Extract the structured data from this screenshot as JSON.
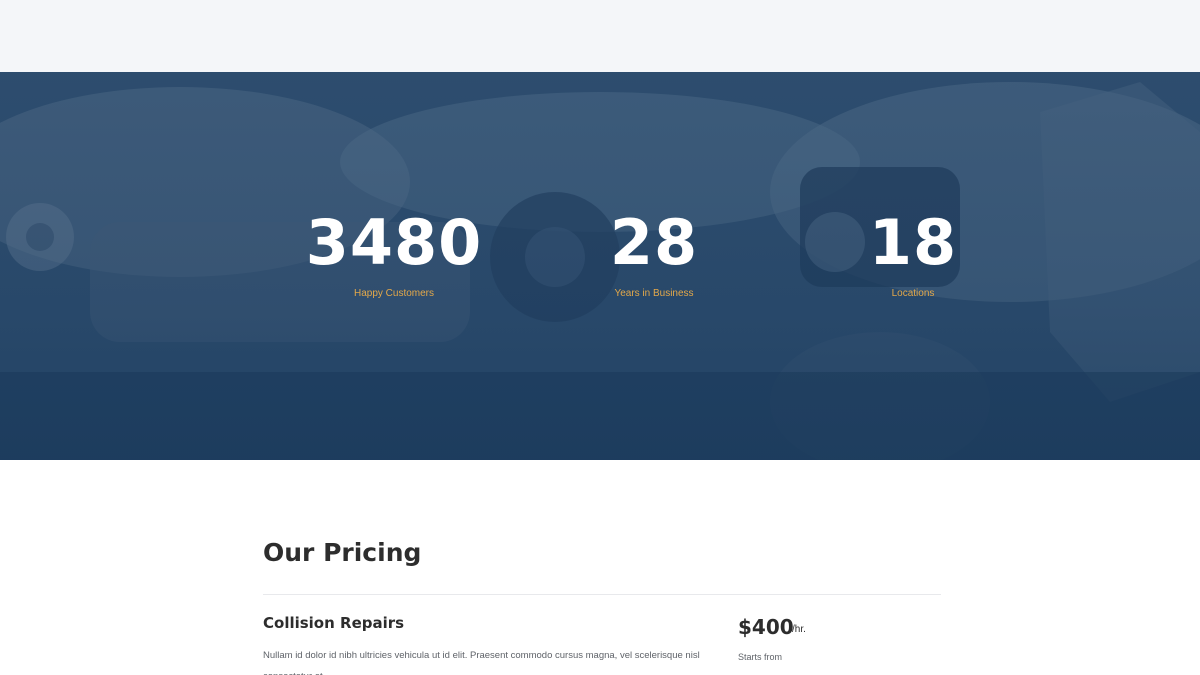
{
  "stats": [
    {
      "value": "3480",
      "label": "Happy Customers"
    },
    {
      "value": "28",
      "label": "Years in Business"
    },
    {
      "value": "18",
      "label": "Locations"
    }
  ],
  "pricing": {
    "title": "Our Pricing",
    "items": [
      {
        "name": "Collision Repairs",
        "description": "Nullam id dolor id nibh ultricies vehicula ut id elit. Praesent commodo cursus magna, vel scelerisque nisl consectetur et.",
        "price": "$400",
        "unit": "/hr.",
        "note": "Starts from"
      }
    ]
  },
  "colors": {
    "accent": "#e3a84a",
    "hero_overlay": "#1b3a5b",
    "heading": "#2d2d2d",
    "body_text": "#5f6369",
    "top_band": "#f4f6f9"
  }
}
